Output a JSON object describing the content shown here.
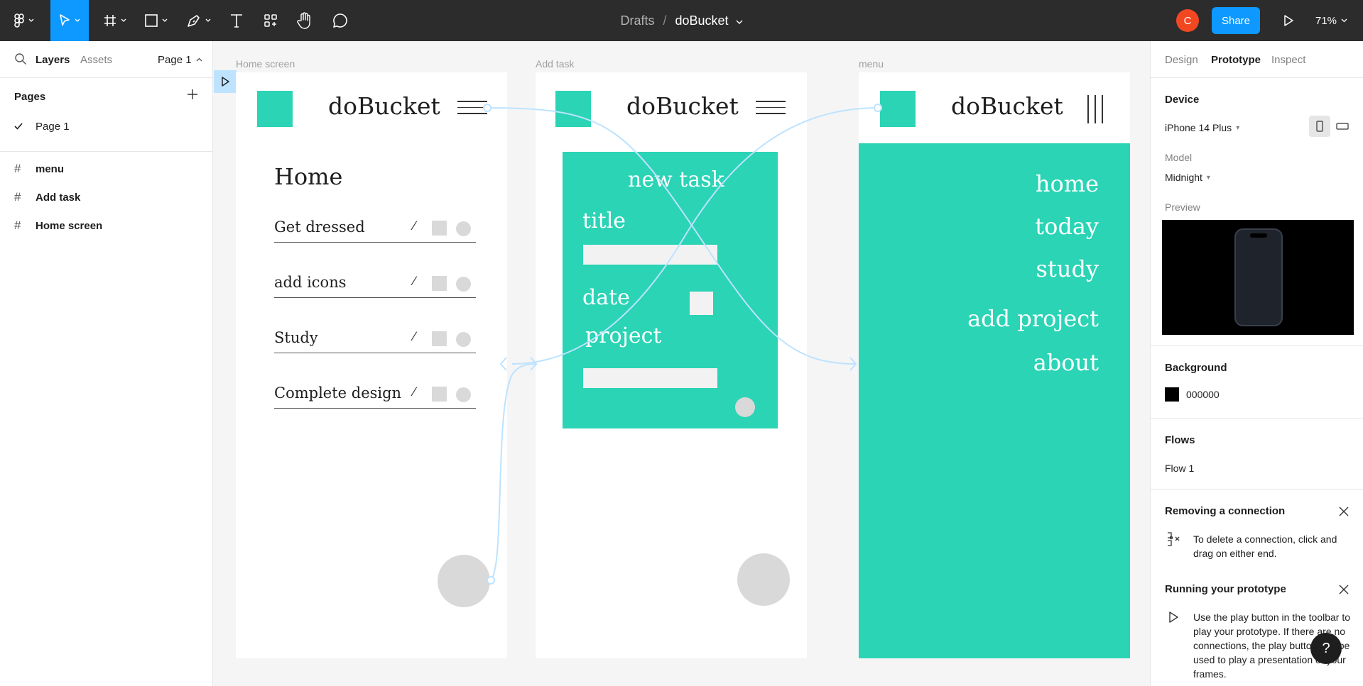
{
  "toolbar": {
    "breadcrumb_drafts": "Drafts",
    "breadcrumb_separator": "/",
    "file_name": "doBucket",
    "avatar_initial": "C",
    "share_label": "Share",
    "zoom": "71%",
    "tools": [
      "figma-main-menu-icon",
      "move-icon",
      "frame-icon",
      "rectangle-icon",
      "pen-icon",
      "text-icon",
      "components-icon",
      "hand-icon",
      "comment-icon"
    ],
    "accent": "#0d99ff"
  },
  "left_panel": {
    "tabs": [
      "Layers",
      "Assets"
    ],
    "current_page": "Page 1",
    "pages_heading": "Pages",
    "pages": [
      {
        "name": "Page 1",
        "selected": true
      }
    ],
    "layers": [
      "menu",
      "Add task",
      "Home screen"
    ]
  },
  "canvas": {
    "frames": {
      "home": {
        "label": "Home screen",
        "app_title": "doBucket",
        "heading": "Home",
        "tasks": [
          "Get dressed",
          "add icons",
          "Study",
          "Complete design"
        ]
      },
      "add_task": {
        "label": "Add task",
        "app_title": "doBucket",
        "card_title": "new task",
        "field_title": "title",
        "field_date": "date",
        "field_project": "project"
      },
      "menu": {
        "label": "menu",
        "app_title": "doBucket",
        "items": [
          "home",
          "today",
          "study",
          "add project",
          "about"
        ]
      }
    },
    "brand_color": "#2ad4b5",
    "connector_color": "#bde3ff"
  },
  "right_panel": {
    "tabs": [
      "Design",
      "Prototype",
      "Inspect"
    ],
    "active_tab": "Prototype",
    "device_heading": "Device",
    "device": "iPhone 14 Plus",
    "model_label": "Model",
    "model": "Midnight",
    "preview_label": "Preview",
    "background_heading": "Background",
    "background_hex": "000000",
    "flows_heading": "Flows",
    "flow": "Flow 1",
    "tip1_title": "Removing a connection",
    "tip1_body": "To delete a connection, click and drag on either end.",
    "tip2_title": "Running your prototype",
    "tip2_body": "Use the play button in the toolbar to play your prototype. If there are no connections, the play button can be used to play a presentation of your frames.",
    "help": "?"
  }
}
